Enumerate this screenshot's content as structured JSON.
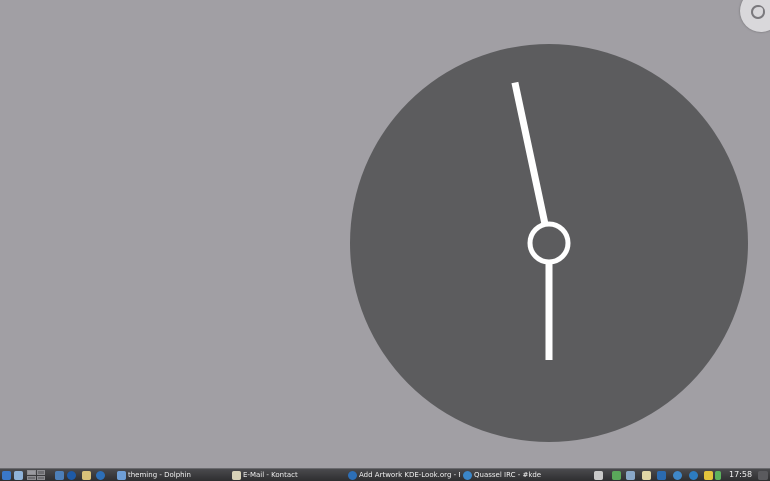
{
  "clock": {
    "hour_hand_angle_deg": 180,
    "minute_hand_angle_deg": 348
  },
  "taskbar": {
    "tasks": [
      {
        "label": "theming - Dolphin",
        "icon": "dolphin-icon"
      },
      {
        "label": "E-Mail - Kontact",
        "icon": "kontact-icon"
      },
      {
        "label": "Add Artwork KDE-Look.org - Firef",
        "icon": "firefox-icon"
      },
      {
        "label": "Quassel IRC - #kde",
        "icon": "quassel-icon"
      }
    ],
    "time": "17:58"
  },
  "colors": {
    "desktop": "#a19fa4",
    "clock_face": "#5c5c5e",
    "hands": "#ffffff",
    "panel": "#3a3a3c"
  }
}
